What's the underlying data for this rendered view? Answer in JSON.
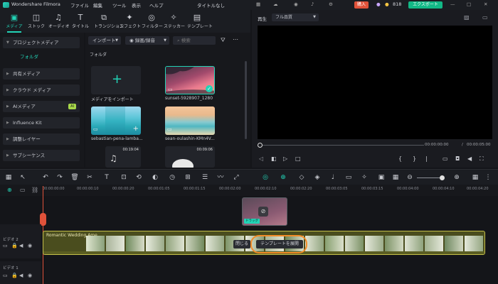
{
  "app": {
    "title": "Wondershare Filmora"
  },
  "menu": [
    "ファイル",
    "編集",
    "ツール",
    "表示",
    "ヘルプ"
  ],
  "project_title": "タイトルなし",
  "purchase_label": "購入",
  "credits": "818",
  "export_label": "エクスポート",
  "toolbar": [
    {
      "label": "メディア",
      "icon": "media-icon"
    },
    {
      "label": "ストック",
      "icon": "stock-icon"
    },
    {
      "label": "オーディオ",
      "icon": "audio-icon"
    },
    {
      "label": "タイトル",
      "icon": "title-icon"
    },
    {
      "label": "トランジション",
      "icon": "transition-icon"
    },
    {
      "label": "エフェクト",
      "icon": "effect-icon"
    },
    {
      "label": "フィルター",
      "icon": "filter-icon"
    },
    {
      "label": "ステッカー",
      "icon": "sticker-icon"
    },
    {
      "label": "テンプレート",
      "icon": "template-icon"
    }
  ],
  "sidebar": {
    "project_media": "プロジェクトメディア",
    "folder": "フォルダ",
    "items": [
      {
        "label": "共有メディア"
      },
      {
        "label": "クラウド メディア"
      },
      {
        "label": "AIメディア",
        "badge": "AI"
      },
      {
        "label": "Influence Kit"
      },
      {
        "label": "調整レイヤー"
      },
      {
        "label": "サブシーケンス"
      }
    ]
  },
  "media": {
    "import_label": "インポート",
    "record_label": "録画/録音",
    "search_placeholder": "検索",
    "folder_heading": "フォルダ",
    "import_tile_label": "メディアをインポート",
    "items": [
      {
        "name": "sunset-5928907_1280"
      },
      {
        "name": "sebastian-pena-lamba..."
      },
      {
        "name": "sean-oulashin-KMn4V..."
      }
    ],
    "durations": [
      "00:19:04",
      "00:09:06"
    ]
  },
  "preview": {
    "tab_player": "再生",
    "quality": "フル品質",
    "current_time": "00:00:00:00",
    "separator": "/",
    "total_time": "00:00:05:00"
  },
  "timeline": {
    "ticks": [
      "00:00:00:00",
      "00:00:00:10",
      "00:00:00:20",
      "00:00:01:05",
      "00:00:01:15",
      "00:00:02:00",
      "00:00:02:10",
      "00:00:02:20",
      "00:00:03:05",
      "00:00:03:15",
      "00:00:04:00",
      "00:00:04:10",
      "00:00:04:20"
    ],
    "track_video2": "ビデオ 2",
    "track_video1": "ビデオ 1",
    "clip_label": "Romantic Wedding Ame...",
    "close_label": "閉じる",
    "expand_label": "テンプレートを展開",
    "drag_badge": "ドラッグ"
  },
  "colors": {
    "accent": "#22d3b6",
    "export": "#12b886",
    "purchase": "#e0523a",
    "clip": "#4a4d1e"
  }
}
